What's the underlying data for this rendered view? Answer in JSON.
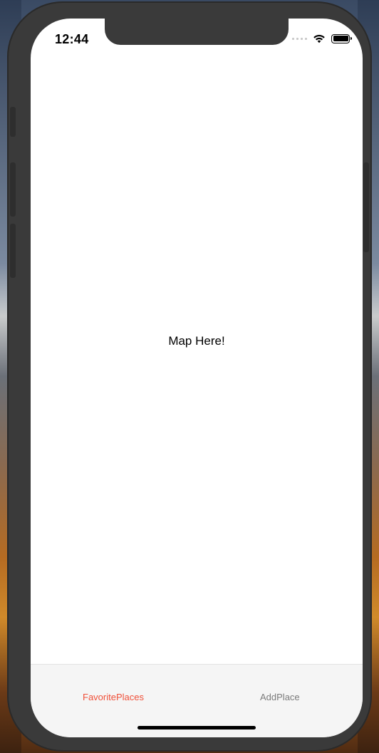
{
  "status_bar": {
    "time": "12:44",
    "icons": [
      "signal-dots",
      "wifi-icon",
      "battery-icon"
    ]
  },
  "main": {
    "text": "Map Here!"
  },
  "tab_bar": {
    "tabs": [
      {
        "label": "FavoritePlaces",
        "active": true,
        "color": "#f0513a"
      },
      {
        "label": "AddPlace",
        "active": false,
        "color": "#7b7b7b"
      }
    ]
  },
  "colors": {
    "tab_active": "#f0513a",
    "tab_inactive": "#7b7b7b",
    "tab_bar_bg": "#f5f5f5",
    "device_frame": "#3a3a3a"
  }
}
